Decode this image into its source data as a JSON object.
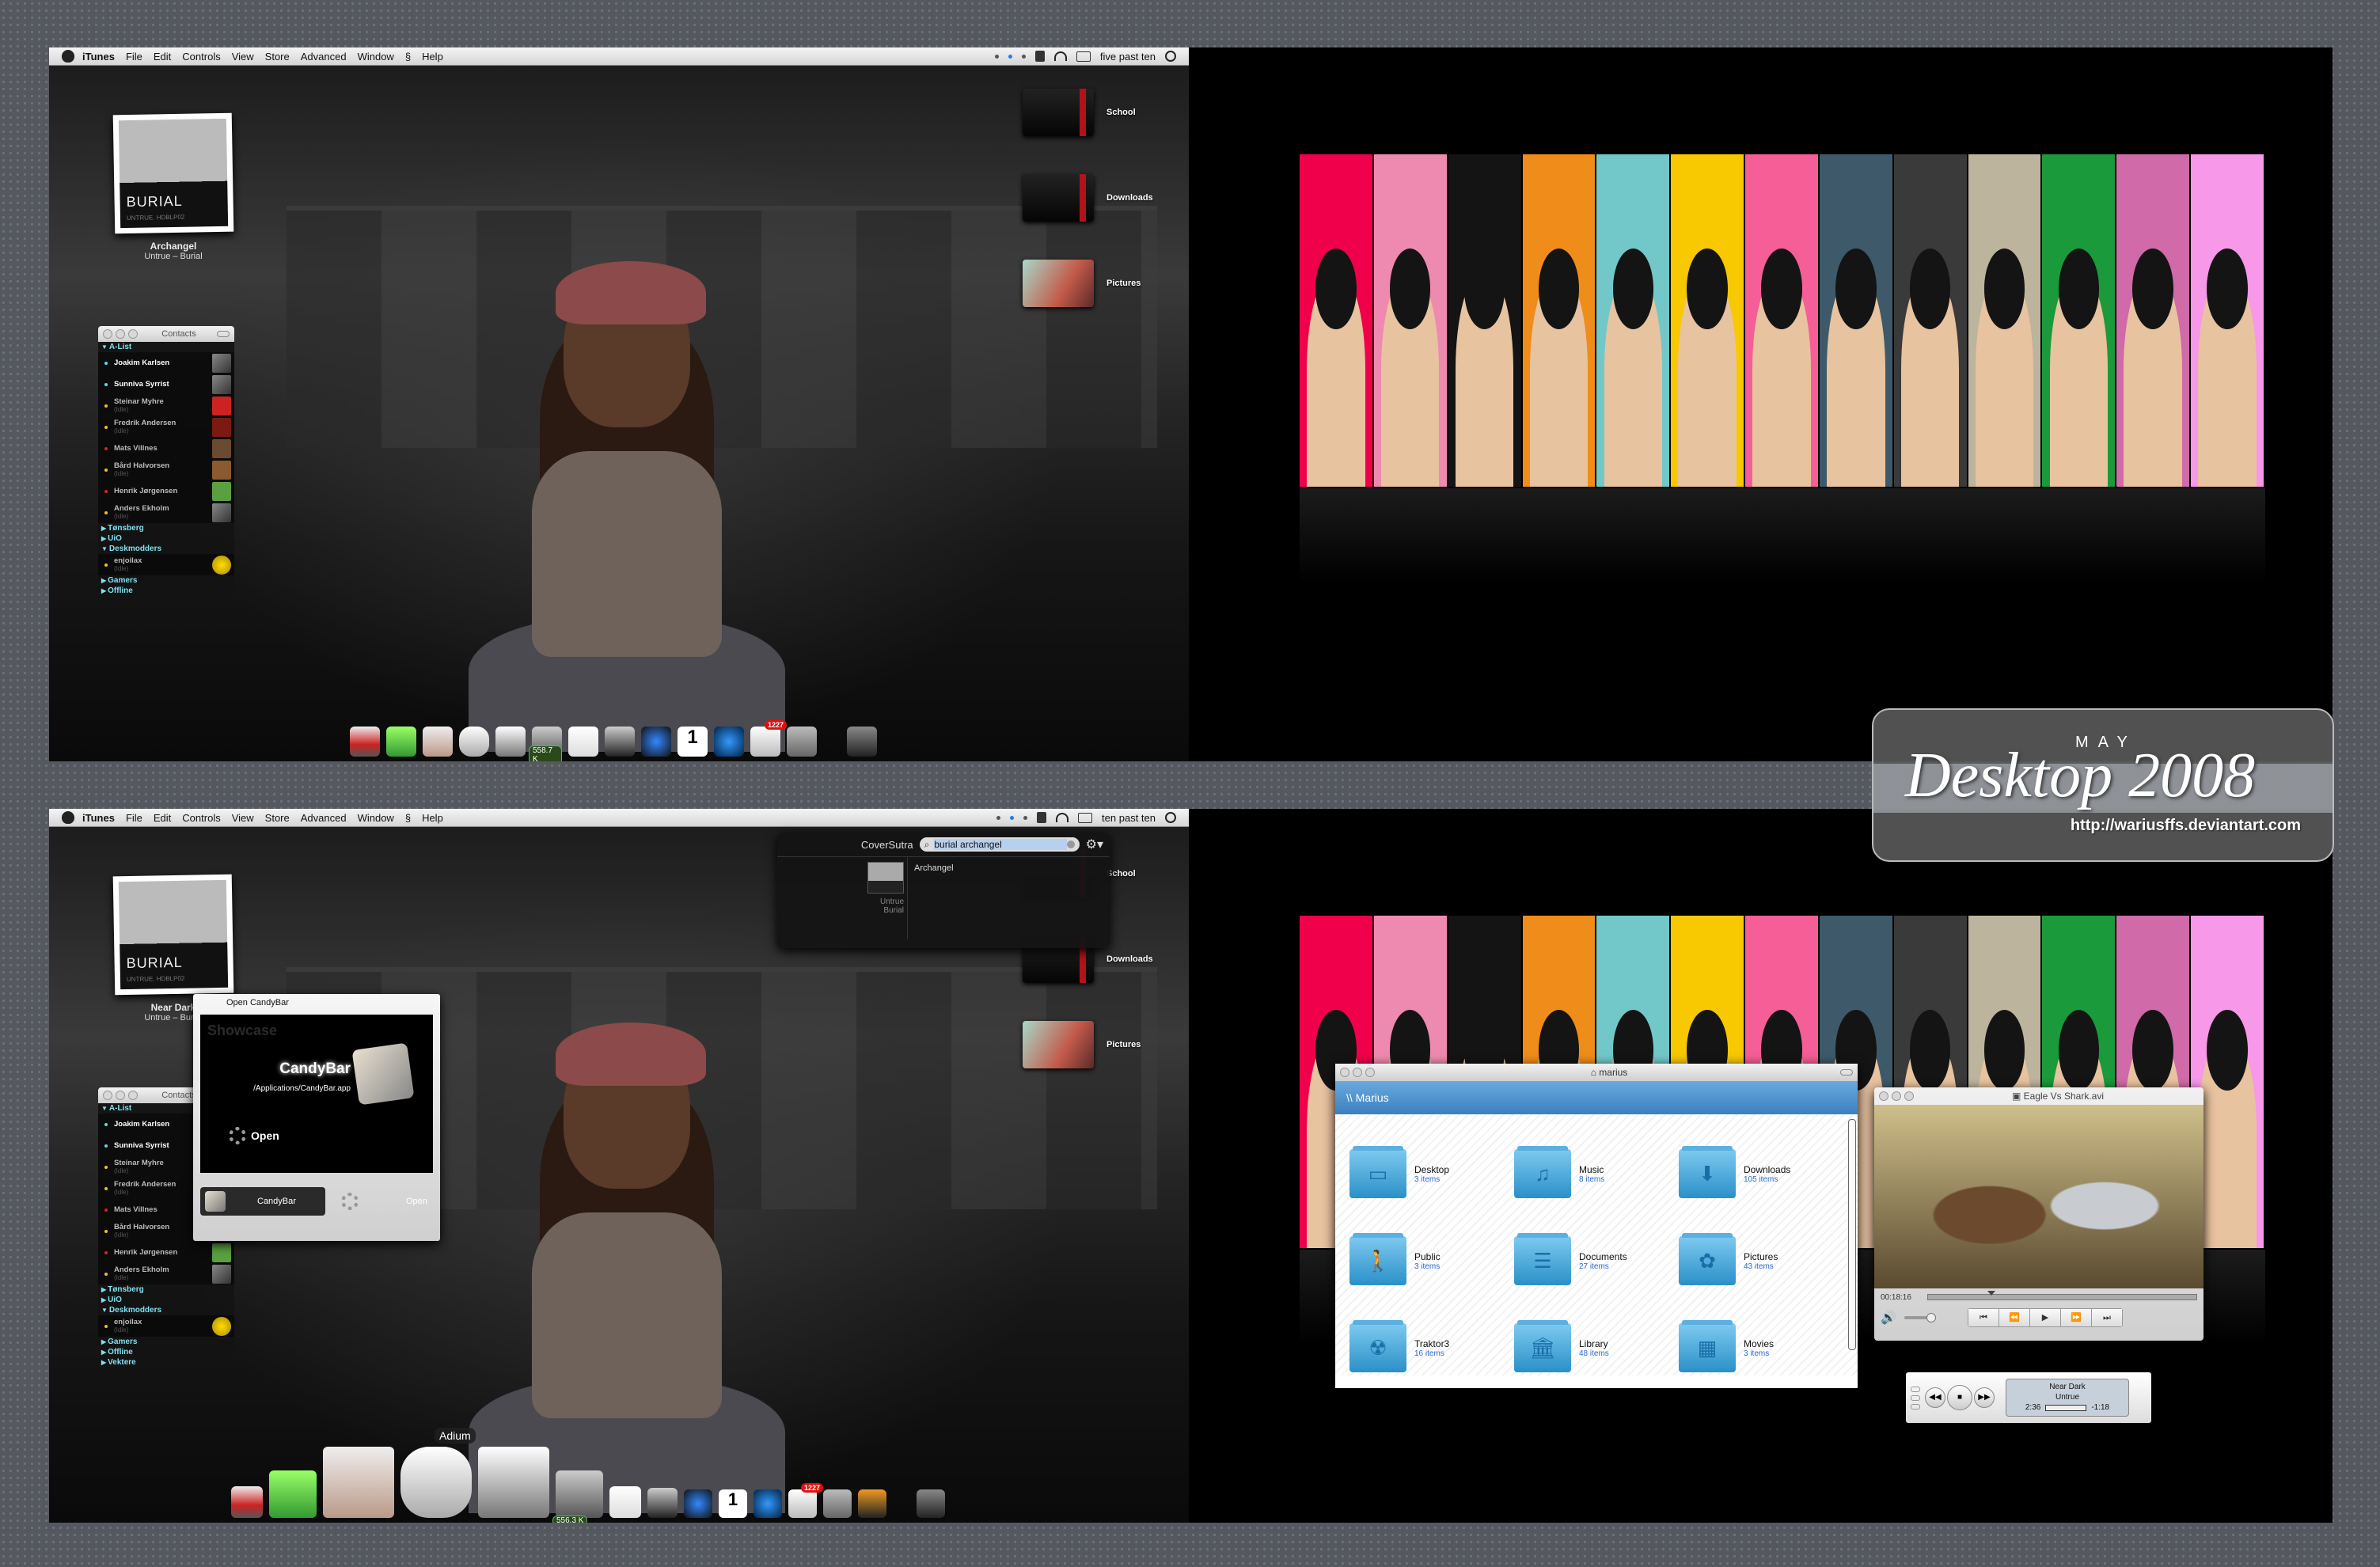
{
  "menubar": {
    "app": "iTunes",
    "items": [
      "File",
      "Edit",
      "Controls",
      "View",
      "Store",
      "Advanced",
      "Window",
      "Help"
    ],
    "clock_top": "five past ten",
    "clock_bottom": "ten past ten"
  },
  "now_playing_top": {
    "track": "Archangel",
    "album_artist": "Untrue – Burial",
    "cover_title": "BURIAL",
    "cover_sub": "UNTRUE. HDBLP02"
  },
  "now_playing_bottom": {
    "track": "Near Dark",
    "album_artist": "Untrue – Burial",
    "cover_title": "BURIAL",
    "cover_sub": "UNTRUE. HDBLP02"
  },
  "contacts": {
    "title": "Contacts",
    "groups": [
      {
        "name": "A-List",
        "expanded": true,
        "members": [
          {
            "name": "Joakim Karlsen",
            "status": "available",
            "idle": ""
          },
          {
            "name": "Sunniva Syrrist",
            "status": "available",
            "idle": ""
          },
          {
            "name": "Steinar Myhre",
            "status": "idle",
            "idle": "(Idle)"
          },
          {
            "name": "Fredrik Andersen",
            "status": "idle",
            "idle": "(Idle)"
          },
          {
            "name": "Mats Villnes",
            "status": "away",
            "idle": ""
          },
          {
            "name": "Bård Halvorsen",
            "status": "idle",
            "idle": "(Idle)"
          },
          {
            "name": "Henrik Jørgensen",
            "status": "away",
            "idle": ""
          },
          {
            "name": "Anders Ekholm",
            "status": "idle",
            "idle": "(Idle)"
          }
        ]
      },
      {
        "name": "Tønsberg",
        "expanded": false
      },
      {
        "name": "UiO",
        "expanded": false
      },
      {
        "name": "Deskmodders",
        "expanded": true,
        "members": [
          {
            "name": "enjoilax",
            "status": "idle",
            "idle": "(Idle)"
          }
        ]
      },
      {
        "name": "Gamers",
        "expanded": false
      },
      {
        "name": "Offline",
        "expanded": false
      }
    ],
    "extra_group_bottom": "Vektere"
  },
  "desktop_folders": [
    "School",
    "Downloads",
    "Pictures"
  ],
  "dock": {
    "stat_top": "558.7 K",
    "stat_bottom": "556.3 K",
    "mail_badge": "1227",
    "tooltip": "Adium",
    "calendar_day": "1"
  },
  "stripe_colors": [
    "#f0004a",
    "#ee8ab0",
    "#141414",
    "#f08c1a",
    "#72c8c8",
    "#f8c800",
    "#f55e96",
    "#3e5a6a",
    "#3a3a3a",
    "#bcb49c",
    "#1a9a3a",
    "#d06aa8",
    "#f898e8"
  ],
  "title_badge": {
    "month": "MAY",
    "title": "Desktop 2008",
    "url": "http://wariusffs.deviantart.com"
  },
  "coversutra": {
    "title": "CoverSutra",
    "query": "burial archangel",
    "result_track": "Archangel",
    "result_album": "Untrue",
    "result_artist": "Burial"
  },
  "candybar": {
    "title": "Open CandyBar",
    "section": "Showcase",
    "app_name": "CandyBar",
    "app_path": "/Applications/CandyBar.app",
    "action": "Open",
    "sel_label": "CandyBar",
    "open_label": "Open"
  },
  "finder": {
    "title": "marius",
    "header": "\\\\ Marius",
    "items": [
      {
        "name": "Desktop",
        "count": "3 items",
        "icon": "▭"
      },
      {
        "name": "Music",
        "count": "8 items",
        "icon": "♫"
      },
      {
        "name": "Downloads",
        "count": "105 items",
        "icon": "⬇"
      },
      {
        "name": "Public",
        "count": "3 items",
        "icon": "🚶"
      },
      {
        "name": "Documents",
        "count": "27 items",
        "icon": "☰"
      },
      {
        "name": "Pictures",
        "count": "43 items",
        "icon": "✿"
      },
      {
        "name": "Traktor3",
        "count": "16 items",
        "icon": "☢"
      },
      {
        "name": "Library",
        "count": "48 items",
        "icon": "🏛"
      },
      {
        "name": "Movies",
        "count": "3 items",
        "icon": "▦"
      }
    ]
  },
  "player": {
    "title": "Eagle Vs Shark.avi",
    "time": "00:18:16",
    "progress": 0.22,
    "buttons": [
      "⏮",
      "⏪",
      "▶",
      "⏩",
      "⏭"
    ]
  },
  "mini_player": {
    "track": "Near Dark",
    "album": "Untrue",
    "elapsed": "2:36",
    "remaining": "-1:18",
    "progress": 0.67
  }
}
